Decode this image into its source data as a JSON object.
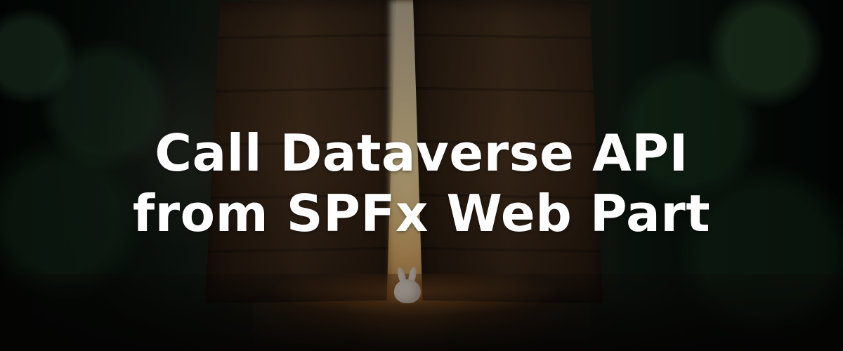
{
  "banner": {
    "title_lines": [
      "Call Dataverse API",
      "from SPFx Web Part"
    ]
  },
  "colors": {
    "title": "#ffffff",
    "light": "#ffd99a",
    "forest": "#1f3a26",
    "door": "#4a321d"
  }
}
